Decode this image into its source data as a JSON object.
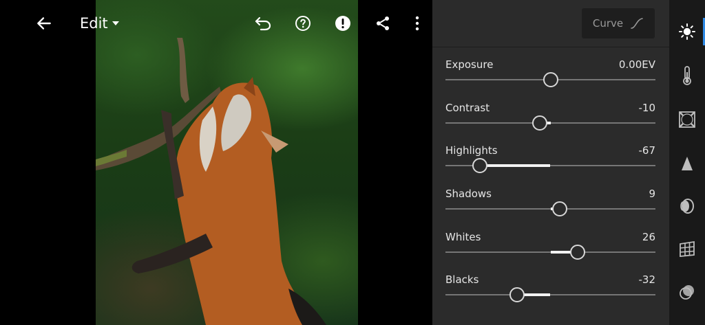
{
  "header": {
    "title": "Edit",
    "back_icon": "arrow-left-icon",
    "undo_icon": "undo-icon",
    "help_icon": "help-circle-icon",
    "alert_icon": "alert-circle-icon",
    "share_icon": "share-icon",
    "more_icon": "more-vertical-icon"
  },
  "panel": {
    "curve_button_label": "Curve",
    "sliders": [
      {
        "label": "Exposure",
        "value": "0.00EV",
        "position": 0.5,
        "fill_from": 0.5
      },
      {
        "label": "Contrast",
        "value": "-10",
        "position": 0.45,
        "fill_from": 0.5
      },
      {
        "label": "Highlights",
        "value": "-67",
        "position": 0.165,
        "fill_from": 0.5
      },
      {
        "label": "Shadows",
        "value": "9",
        "position": 0.545,
        "fill_from": 0.5
      },
      {
        "label": "Whites",
        "value": "26",
        "position": 0.63,
        "fill_from": 0.5
      },
      {
        "label": "Blacks",
        "value": "-32",
        "position": 0.34,
        "fill_from": 0.5
      }
    ]
  },
  "rail": {
    "items": [
      {
        "name": "light-icon",
        "active": true
      },
      {
        "name": "color-temperature-icon",
        "active": false
      },
      {
        "name": "effects-vignette-icon",
        "active": false
      },
      {
        "name": "detail-sharpen-icon",
        "active": false
      },
      {
        "name": "optics-lens-icon",
        "active": false
      },
      {
        "name": "geometry-icon",
        "active": false
      },
      {
        "name": "color-mix-icon",
        "active": false
      }
    ]
  },
  "colors": {
    "panel_bg": "#2b2b2b",
    "rail_bg": "#191919",
    "accent": "#2f8ae5"
  }
}
